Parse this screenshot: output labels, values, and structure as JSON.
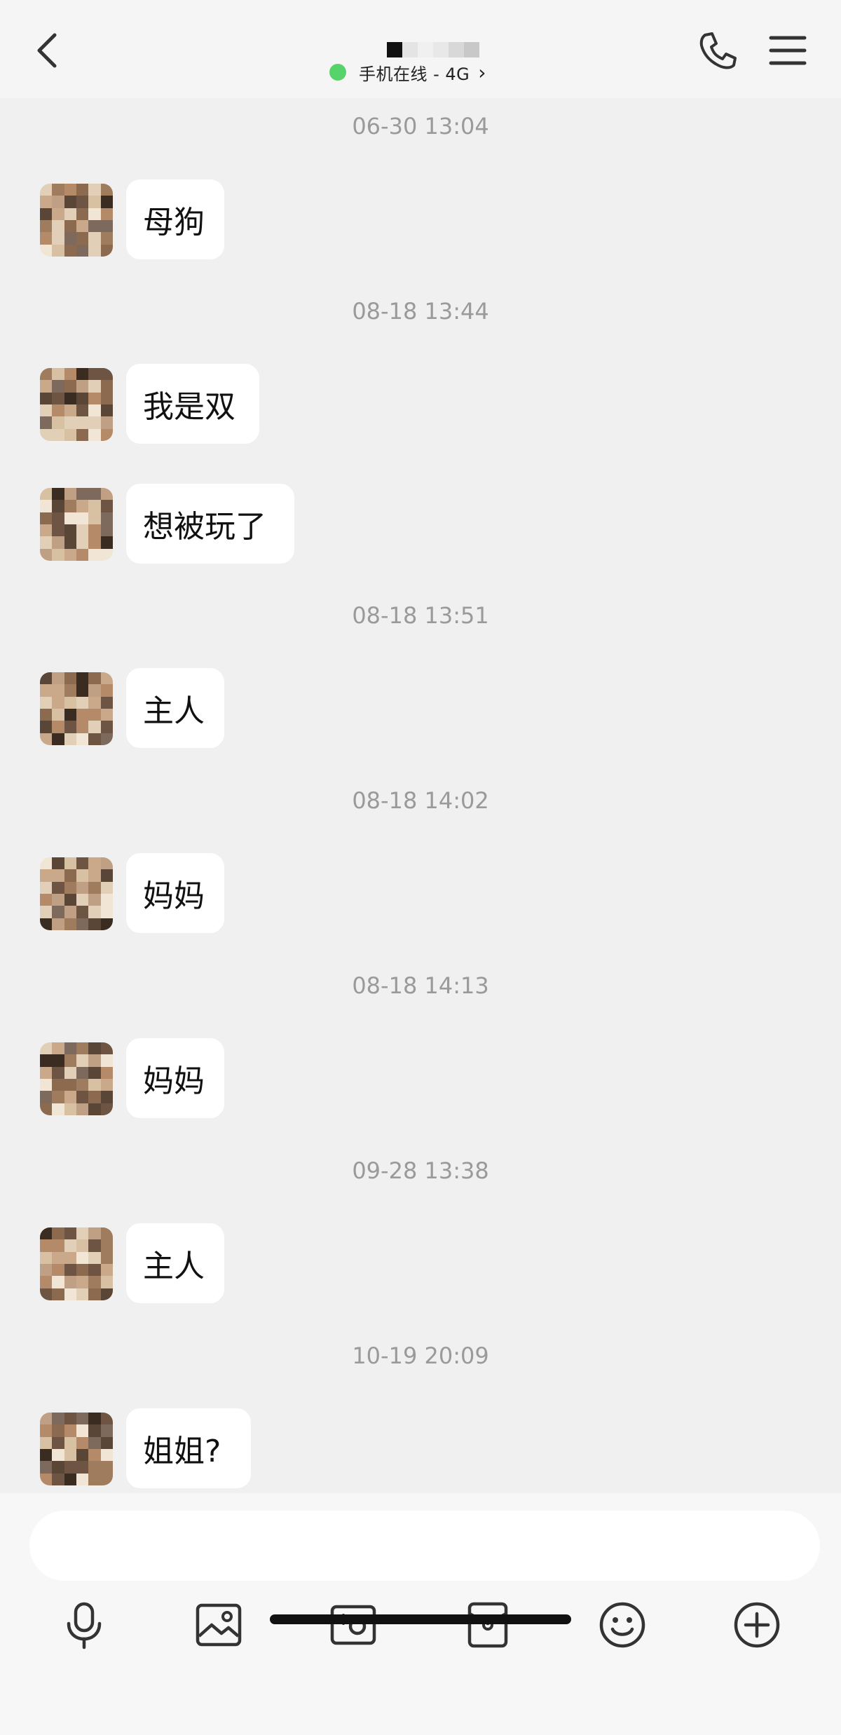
{
  "header": {
    "status_text": "手机在线 - 4G",
    "chevron": "›",
    "status_color": "#57d36b",
    "icons": {
      "back": "chevron-left-icon",
      "call": "phone-icon",
      "menu": "hamburger-menu-icon"
    }
  },
  "messages": [
    {
      "time": "06-30 13:04",
      "text": "母狗"
    },
    {
      "time": "08-18 13:44",
      "text": "我是双"
    },
    {
      "time": null,
      "text": "想被玩了"
    },
    {
      "time": "08-18 13:51",
      "text": "主人"
    },
    {
      "time": "08-18 14:02",
      "text": "妈妈"
    },
    {
      "time": "08-18 14:13",
      "text": "妈妈"
    },
    {
      "time": "09-28 13:38",
      "text": "主人"
    },
    {
      "time": "10-19 20:09",
      "text": "姐姐?"
    }
  ],
  "toolbar": {
    "icons": [
      "microphone-icon",
      "image-icon",
      "camera-icon",
      "red-packet-icon",
      "emoji-icon",
      "plus-circle-icon"
    ]
  },
  "input": {
    "value": "",
    "placeholder": ""
  }
}
